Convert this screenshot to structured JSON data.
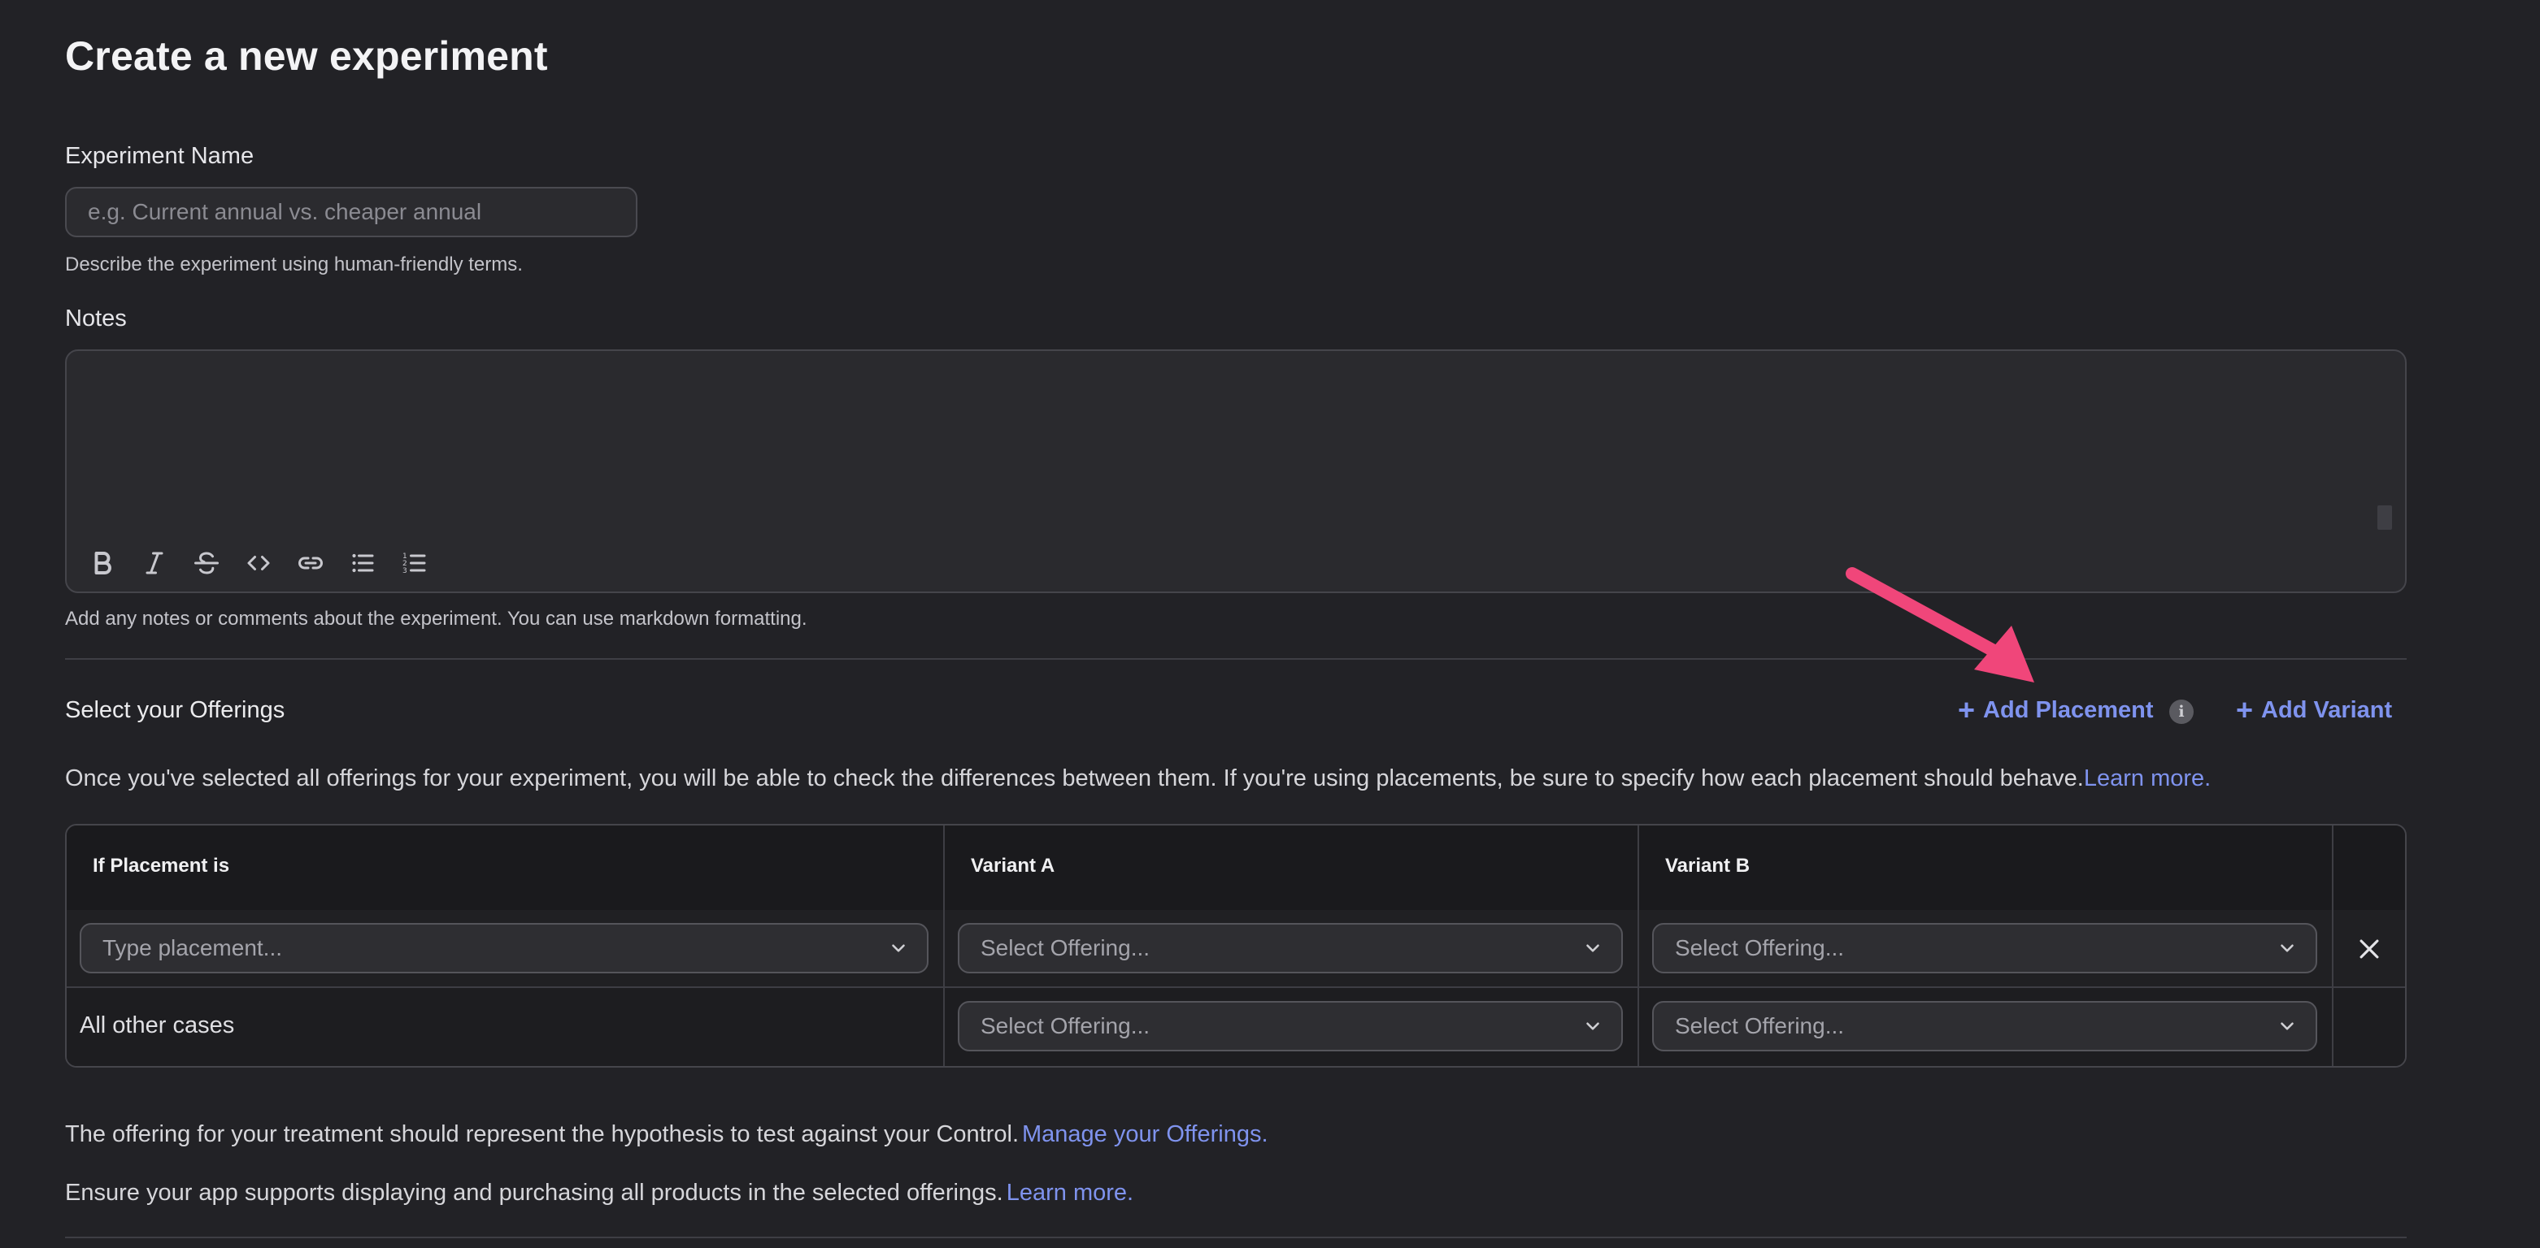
{
  "page": {
    "title": "Create a new experiment"
  },
  "experiment_name": {
    "label": "Experiment Name",
    "placeholder": "e.g. Current annual vs. cheaper annual",
    "value": "",
    "help": "Describe the experiment using human-friendly terms."
  },
  "notes": {
    "label": "Notes",
    "value": "",
    "help": "Add any notes or comments about the experiment. You can use markdown formatting.",
    "toolbar": [
      {
        "name": "bold-icon"
      },
      {
        "name": "italic-icon"
      },
      {
        "name": "strikethrough-icon"
      },
      {
        "name": "code-icon"
      },
      {
        "name": "link-icon"
      },
      {
        "name": "bulleted-list-icon"
      },
      {
        "name": "numbered-list-icon"
      }
    ]
  },
  "offerings": {
    "title": "Select your Offerings",
    "add_placement_label": "Add Placement",
    "add_variant_label": "Add Variant",
    "info_icon": "i",
    "description": "Once you've selected all offerings for your experiment, you will be able to check the differences between them. If you're using placements, be sure to specify how each placement should behave.",
    "learn_more": "Learn more."
  },
  "table": {
    "headers": [
      "If Placement is",
      "Variant A",
      "Variant B"
    ],
    "rows": [
      {
        "placement_placeholder": "Type placement...",
        "variant_a": "Select Offering...",
        "variant_b": "Select Offering..."
      },
      {
        "placement_text": "All other cases",
        "variant_a": "Select Offering...",
        "variant_b": "Select Offering..."
      }
    ]
  },
  "footer": {
    "treatment_text": "The offering for your treatment should represent the hypothesis to test against your Control.",
    "manage_link": "Manage your Offerings.",
    "support_text": "Ensure your app supports displaying and purchasing all products in the selected offerings.",
    "support_link": "Learn more."
  },
  "colors": {
    "background": "#222226",
    "accent_link": "#7f93ee",
    "annotation_arrow": "#f0467a"
  }
}
